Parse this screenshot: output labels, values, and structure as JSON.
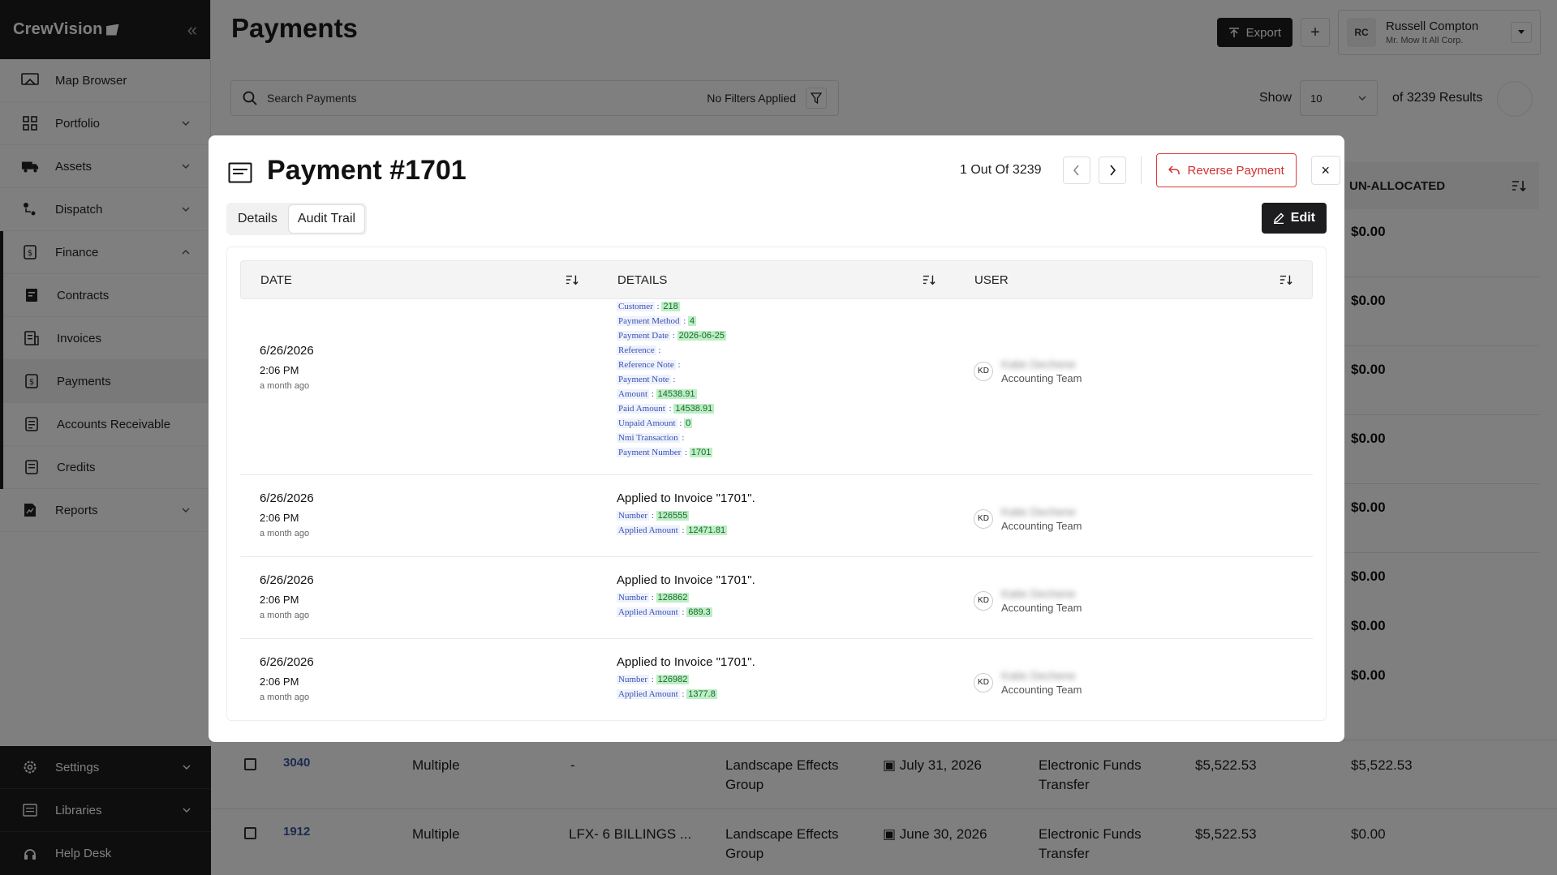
{
  "sidebar": {
    "brand": "CrewVision",
    "items": [
      {
        "label": "Map Browser",
        "icon": "map-icon"
      },
      {
        "label": "Portfolio",
        "icon": "grid-icon"
      },
      {
        "label": "Assets",
        "icon": "truck-icon"
      },
      {
        "label": "Dispatch",
        "icon": "dispatch-icon"
      },
      {
        "label": "Finance",
        "icon": "finance-icon"
      },
      {
        "label": "Contracts",
        "icon": "contract-icon"
      },
      {
        "label": "Invoices",
        "icon": "invoice-icon"
      },
      {
        "label": "Payments",
        "icon": "payment-icon"
      },
      {
        "label": "Accounts Receivable",
        "icon": "receivable-icon"
      },
      {
        "label": "Credits",
        "icon": "credit-icon"
      },
      {
        "label": "Reports",
        "icon": "report-icon"
      }
    ],
    "bottom": [
      {
        "label": "Settings",
        "icon": "gear-icon"
      },
      {
        "label": "Libraries",
        "icon": "library-icon"
      },
      {
        "label": "Help Desk",
        "icon": "headset-icon"
      }
    ]
  },
  "header": {
    "title": "Payments",
    "export_label": "Export",
    "plus_label": "+",
    "user_initials": "RC",
    "user_name": "Russell Compton",
    "user_org": "Mr. Mow It All Corp."
  },
  "search": {
    "placeholder": "Search Payments",
    "filter_status": "No Filters Applied"
  },
  "pagination": {
    "show_label": "Show",
    "per_page": "10",
    "results": "of 3239 Results"
  },
  "background_table": {
    "unallocated_header": "UN-ALLOCATED",
    "unallocated_values": [
      "$0.00",
      "$0.00",
      "$0.00",
      "$0.00",
      "$0.00",
      "$0.00",
      "$0.00",
      "$0.00"
    ],
    "rows": [
      {
        "number": "3040",
        "invoice": "Multiple",
        "reference": "-",
        "customer": "Landscape Effects Group",
        "date": "July 31, 2026",
        "method": "Electronic Funds Transfer",
        "amount": "$5,522.53",
        "unallocated": "$5,522.53"
      },
      {
        "number": "1912",
        "invoice": "Multiple",
        "reference": "LFX- 6 BILLINGS ...",
        "customer": "Landscape Effects Group",
        "date": "June 30, 2026",
        "method": "Electronic Funds Transfer",
        "amount": "$5,522.53",
        "unallocated": "$0.00"
      }
    ]
  },
  "modal": {
    "title": "Payment #1701",
    "position": "1 Out Of 3239",
    "reverse_label": "Reverse Payment",
    "close_label": "×",
    "edit_label": "Edit",
    "tabs": [
      {
        "label": "Details"
      },
      {
        "label": "Audit Trail"
      }
    ],
    "columns": {
      "date": "DATE",
      "details": "DETAILS",
      "user": "USER"
    },
    "entries": [
      {
        "date": "6/26/2026",
        "time": "2:06 PM",
        "ago": "a month ago",
        "title": "",
        "fields": [
          {
            "k": "Customer",
            "v": "218"
          },
          {
            "k": "Payment Method",
            "v": "4"
          },
          {
            "k": "Payment Date",
            "v": "2026-06-25"
          },
          {
            "k": "Reference",
            "v": ""
          },
          {
            "k": "Reference Note",
            "v": ""
          },
          {
            "k": "Payment Note",
            "v": ""
          },
          {
            "k": "Amount",
            "v": "14538.91"
          },
          {
            "k": "Paid Amount",
            "v": "14538.91"
          },
          {
            "k": "Unpaid Amount",
            "v": "0"
          },
          {
            "k": "Nmi Transaction",
            "v": ""
          },
          {
            "k": "Payment Number",
            "v": "1701"
          }
        ],
        "initials": "KD",
        "user": "Katie Dechene",
        "team": "Accounting Team"
      },
      {
        "date": "6/26/2026",
        "time": "2:06 PM",
        "ago": "a month ago",
        "title": "Applied to Invoice \"1701\".",
        "fields": [
          {
            "k": "Number",
            "v": "126555"
          },
          {
            "k": "Applied Amount",
            "v": "12471.81"
          }
        ],
        "initials": "KD",
        "user": "Katie Dechene",
        "team": "Accounting Team"
      },
      {
        "date": "6/26/2026",
        "time": "2:06 PM",
        "ago": "a month ago",
        "title": "Applied to Invoice \"1701\".",
        "fields": [
          {
            "k": "Number",
            "v": "126862"
          },
          {
            "k": "Applied Amount",
            "v": "689.3"
          }
        ],
        "initials": "KD",
        "user": "Katie Dechene",
        "team": "Accounting Team"
      },
      {
        "date": "6/26/2026",
        "time": "2:06 PM",
        "ago": "a month ago",
        "title": "Applied to Invoice \"1701\".",
        "fields": [
          {
            "k": "Number",
            "v": "126982"
          },
          {
            "k": "Applied Amount",
            "v": "1377.8"
          }
        ],
        "initials": "KD",
        "user": "Katie Dechene",
        "team": "Accounting Team"
      }
    ]
  }
}
